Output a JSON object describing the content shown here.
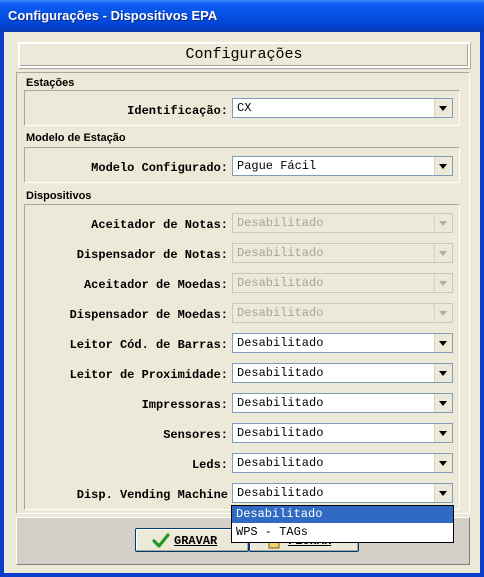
{
  "window": {
    "title": "Configurações - Dispositivos EPA"
  },
  "header": {
    "title": "Configurações"
  },
  "groups": {
    "estacoes": "Estações",
    "modelo": "Modelo de Estação",
    "dispositivos": "Dispositivos"
  },
  "fields": {
    "identificacao": {
      "label": "Identificação:",
      "value": "CX"
    },
    "modelo_configurado": {
      "label": "Modelo Configurado:",
      "value": "Pague Fácil"
    },
    "aceitador_notas": {
      "label": "Aceitador de Notas:",
      "value": "Desabilitado",
      "disabled": true
    },
    "dispensador_notas": {
      "label": "Dispensador de Notas:",
      "value": "Desabilitado",
      "disabled": true
    },
    "aceitador_moedas": {
      "label": "Aceitador de Moedas:",
      "value": "Desabilitado",
      "disabled": true
    },
    "dispensador_moedas": {
      "label": "Dispensador de Moedas:",
      "value": "Desabilitado",
      "disabled": true
    },
    "leitor_barras": {
      "label": "Leitor Cód. de Barras:",
      "value": "Desabilitado"
    },
    "leitor_proximidade": {
      "label": "Leitor de Proximidade:",
      "value": "Desabilitado"
    },
    "impressoras": {
      "label": "Impressoras:",
      "value": "Desabilitado"
    },
    "sensores": {
      "label": "Sensores:",
      "value": "Desabilitado"
    },
    "leds": {
      "label": "Leds:",
      "value": "Desabilitado"
    },
    "vending": {
      "label": "Disp. Vending Machine",
      "value": "Desabilitado"
    }
  },
  "dropdown": {
    "options": [
      "Desabilitado",
      "WPS - TAGs"
    ],
    "selected": "Desabilitado"
  },
  "buttons": {
    "gravar": "GRAVAR",
    "fechar": "FECHAR"
  },
  "colors": {
    "titlebar": "#0350e3",
    "dialog_bg": "#ece9d8",
    "selection": "#316ac5",
    "check_green": "#1e9a1e",
    "close_red": "#c0282a"
  }
}
